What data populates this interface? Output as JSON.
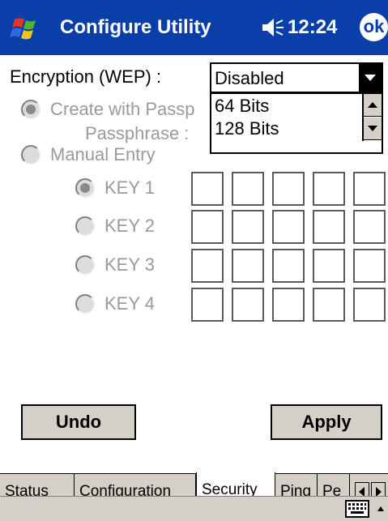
{
  "titlebar": {
    "title": "Configure Utility",
    "time": "12:24",
    "ok_label": "ok",
    "start_icon": "windows-flag-icon",
    "speaker_icon": "speaker-icon"
  },
  "encryption": {
    "label": "Encryption (WEP) :",
    "selected": "Disabled",
    "options": [
      "64 Bits",
      "128 Bits"
    ]
  },
  "passphrase_option": {
    "label": "Create with Passp",
    "field_label": "Passphrase :"
  },
  "manual_option": {
    "label": "Manual Entry"
  },
  "keys": [
    {
      "label": "KEY 1",
      "checked": true
    },
    {
      "label": "KEY 2",
      "checked": false
    },
    {
      "label": "KEY 3",
      "checked": false
    },
    {
      "label": "KEY 4",
      "checked": false
    }
  ],
  "buttons": {
    "undo": "Undo",
    "apply": "Apply"
  },
  "tabs": [
    {
      "label": "Status",
      "active": false
    },
    {
      "label": "Configuration",
      "active": false
    },
    {
      "label": "Security",
      "active": true
    },
    {
      "label": "Ping",
      "active": false
    },
    {
      "label": "Pe",
      "active": false
    }
  ],
  "colors": {
    "titlebar": "#0a3fa9",
    "control_face": "#d4d0c8",
    "disabled_text": "#9a9a9a"
  }
}
